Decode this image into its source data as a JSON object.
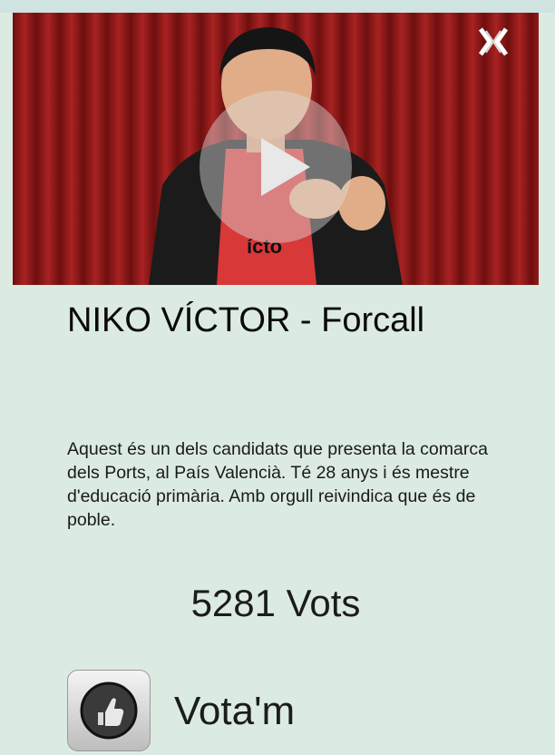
{
  "candidate": {
    "title": "NIKO VÍCTOR - Forcall",
    "description": "Aquest és un dels candidats que presenta la comarca dels Ports, al País Valencià. Té 28 anys i és mestre d'educació primària. Amb orgull reivindica que és de poble.",
    "votes": "5281 Vots",
    "shirt_text": "ícto"
  },
  "actions": {
    "vote_label": "Vota'm"
  },
  "icons": {
    "close": "close-icon",
    "play": "play-icon",
    "vote": "thumbs-up-icon"
  },
  "colors": {
    "background": "#dcebe2",
    "curtain": "#8b1818",
    "text": "#0a0a0a"
  }
}
